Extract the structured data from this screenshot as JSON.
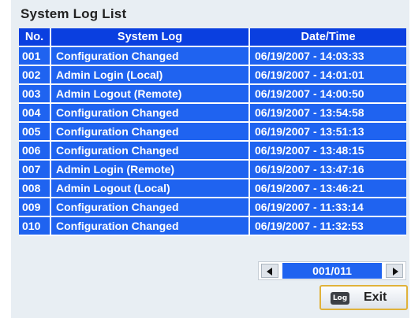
{
  "title": "System Log List",
  "table": {
    "headers": [
      "No.",
      "System Log",
      "Date/Time"
    ],
    "rows": [
      {
        "no": "001",
        "log": "Configuration Changed",
        "datetime": "06/19/2007 - 14:03:33"
      },
      {
        "no": "002",
        "log": "Admin Login (Local)",
        "datetime": "06/19/2007 - 14:01:01"
      },
      {
        "no": "003",
        "log": "Admin Logout (Remote)",
        "datetime": "06/19/2007 - 14:00:50"
      },
      {
        "no": "004",
        "log": "Configuration Changed",
        "datetime": "06/19/2007 - 13:54:58"
      },
      {
        "no": "005",
        "log": "Configuration Changed",
        "datetime": "06/19/2007 - 13:51:13"
      },
      {
        "no": "006",
        "log": "Configuration Changed",
        "datetime": "06/19/2007 - 13:48:15"
      },
      {
        "no": "007",
        "log": "Admin Login (Remote)",
        "datetime": "06/19/2007 - 13:47:16"
      },
      {
        "no": "008",
        "log": "Admin Logout (Local)",
        "datetime": "06/19/2007 - 13:46:21"
      },
      {
        "no": "009",
        "log": "Configuration Changed",
        "datetime": "06/19/2007 - 11:33:14"
      },
      {
        "no": "010",
        "log": "Configuration Changed",
        "datetime": "06/19/2007 - 11:32:53"
      }
    ]
  },
  "pager": {
    "value": "001/011",
    "prev_icon": "triangle-left-icon",
    "next_icon": "triangle-right-icon"
  },
  "exit_button": {
    "icon_text": "Log",
    "label": "Exit"
  },
  "colors": {
    "header_bg": "#0a3fe0",
    "cell_bg": "#1f63f0",
    "panel_bg": "#e8eef3",
    "button_border": "#e0b23a"
  }
}
